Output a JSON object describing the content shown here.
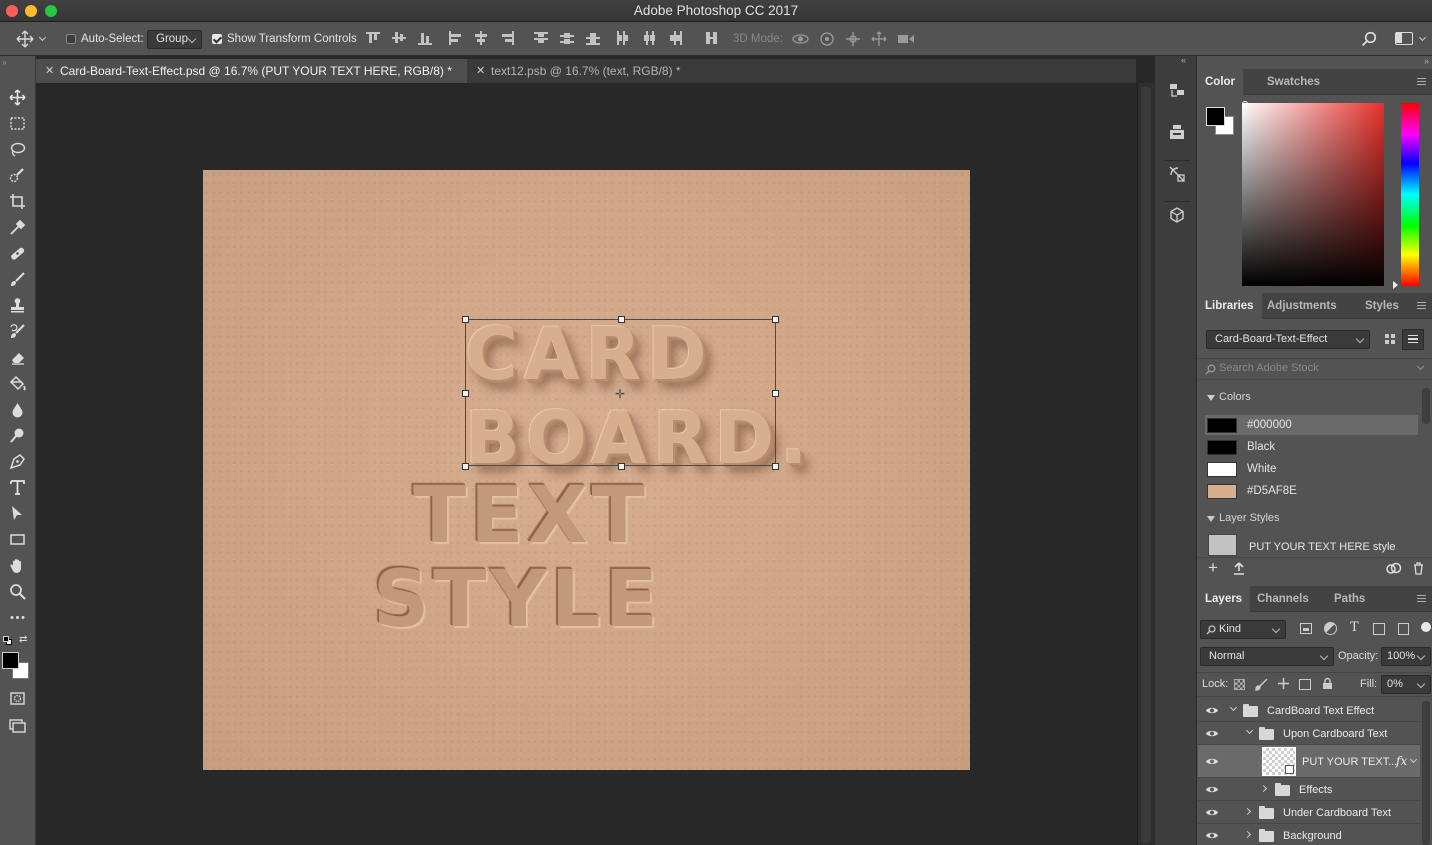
{
  "window": {
    "title": "Adobe Photoshop CC 2017"
  },
  "options_bar": {
    "auto_select_label": "Auto-Select:",
    "auto_select_checked": false,
    "auto_select_target": "Group",
    "transform_controls_label": "Show Transform Controls",
    "transform_controls_checked": true,
    "mode_3d_label": "3D Mode:"
  },
  "documents": [
    {
      "title": "Card-Board-Text-Effect.psd @ 16.7% (PUT YOUR TEXT HERE, RGB/8) *",
      "active": true
    },
    {
      "title": "text12.psb @ 16.7% (text, RGB/8) *",
      "active": false
    }
  ],
  "artwork": {
    "raised_line1": "CARD",
    "raised_line2": "BOARD.",
    "engraved_line1": "TEXT",
    "engraved_line2": "STYLE",
    "paper_color": "#D5AF8E"
  },
  "color_panel": {
    "tabs": [
      "Color",
      "Swatches"
    ],
    "foreground": "#000000",
    "background": "#ffffff"
  },
  "libraries_panel": {
    "tabs": [
      "Libraries",
      "Adjustments",
      "Styles"
    ],
    "library_name": "Card-Board-Text-Effect",
    "search_placeholder": "Search Adobe Stock",
    "colors_heading": "Colors",
    "colors": [
      {
        "label": "#000000",
        "hex": "#000000",
        "selected": true
      },
      {
        "label": "Black",
        "hex": "#000000",
        "selected": false
      },
      {
        "label": "White",
        "hex": "#ffffff",
        "selected": false
      },
      {
        "label": "#D5AF8E",
        "hex": "#D5AF8E",
        "selected": false
      }
    ],
    "layer_styles_heading": "Layer Styles",
    "layer_styles": [
      "PUT YOUR TEXT HERE style"
    ]
  },
  "layers_panel": {
    "tabs": [
      "Layers",
      "Channels",
      "Paths"
    ],
    "filter_kind": "Kind",
    "blend_mode": "Normal",
    "opacity_label": "Opacity:",
    "opacity": "100%",
    "lock_label": "Lock:",
    "fill_label": "Fill:",
    "fill": "0%",
    "layers": [
      {
        "name": "CardBoard Text Effect",
        "kind": "group",
        "level": 0,
        "expanded": true
      },
      {
        "name": "Upon Cardboard Text",
        "kind": "group",
        "level": 1,
        "expanded": true
      },
      {
        "name": "PUT YOUR TEXT...",
        "kind": "smart-object",
        "level": 2,
        "fx": "fx",
        "selected": true
      },
      {
        "name": "Effects",
        "kind": "group",
        "level": 2,
        "expanded": false
      },
      {
        "name": "Under Cardboard Text",
        "kind": "group",
        "level": 1,
        "expanded": false
      },
      {
        "name": "Background",
        "kind": "group",
        "level": 1,
        "expanded": false
      }
    ]
  },
  "tools": [
    "move-tool",
    "marquee-tool",
    "lasso-tool",
    "quick-select-tool",
    "crop-tool",
    "eyedropper-tool",
    "healing-brush-tool",
    "brush-tool",
    "clone-stamp-tool",
    "history-brush-tool",
    "eraser-tool",
    "gradient-tool",
    "blur-tool",
    "dodge-tool",
    "pen-tool",
    "type-tool",
    "path-select-tool",
    "rectangle-tool",
    "hand-tool",
    "zoom-tool",
    "more-tools"
  ]
}
